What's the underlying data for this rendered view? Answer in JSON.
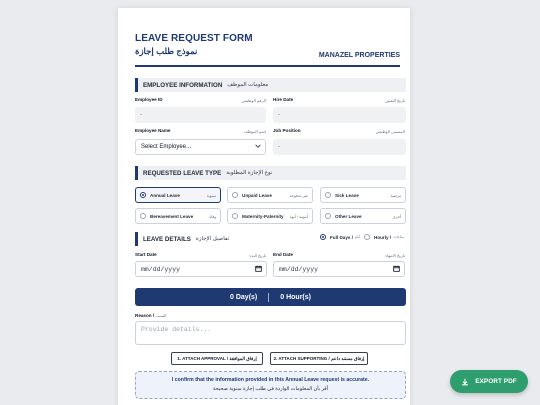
{
  "header": {
    "title": "LEAVE REQUEST FORM",
    "title_ar": "نموذج طلب إجازة",
    "company": "MANAZEL PROPERTIES"
  },
  "employee_info": {
    "heading": "EMPLOYEE INFORMATION",
    "heading_ar": "معلومات الموظف",
    "employee_id_label": "Employee ID",
    "employee_id_label_ar": "الرقم الوظيفي",
    "employee_id_value": "-",
    "hire_date_label": "Hire Date",
    "hire_date_label_ar": "تاريخ التعيين",
    "hire_date_value": "-",
    "employee_name_label": "Employee Name",
    "employee_name_label_ar": "اسم الموظف",
    "employee_name_selected": "Select Employee...",
    "job_position_label": "Job Position",
    "job_position_label_ar": "المسمى الوظيفي",
    "job_position_value": "-"
  },
  "leave_type": {
    "heading": "REQUESTED LEAVE TYPE",
    "heading_ar": "نوع الإجازة المطلوبة",
    "options": [
      {
        "label": "Annual Leave",
        "label_ar": "سنوية",
        "selected": true
      },
      {
        "label": "Unpaid Leave",
        "label_ar": "غير مدفوعة",
        "selected": false
      },
      {
        "label": "Sick Leave",
        "label_ar": "مرضية",
        "selected": false
      },
      {
        "label": "Bereavement Leave",
        "label_ar": "وفاة",
        "selected": false
      },
      {
        "label": "Maternity-Paternity",
        "label_ar": "أمومة / أبوة",
        "selected": false
      },
      {
        "label": "Other Leave",
        "label_ar": "أخرى",
        "selected": false
      }
    ]
  },
  "leave_details": {
    "heading": "LEAVE DETAILS",
    "heading_ar": "تفاصيل الإجازة",
    "full_days_label": "Full Days /",
    "full_days_label_ar": "أيام",
    "hourly_label": "Hourly /",
    "hourly_label_ar": "ساعات",
    "start_date_label": "Start Date",
    "start_date_label_ar": "تاريخ البدء",
    "start_date_placeholder": "mm/dd/yyyy",
    "end_date_label": "End Date",
    "end_date_label_ar": "تاريخ الانتهاء",
    "end_date_placeholder": "mm/dd/yyyy"
  },
  "summary": {
    "days": "0 Day(s)",
    "hours": "0 Hour(s)"
  },
  "reason": {
    "label": "Reason /",
    "label_ar": "السبب",
    "placeholder": "Provide details..."
  },
  "attachments": {
    "approval": "1. ATTACH APPROVAL / إرفاق الموافقة",
    "supporting": "2. ATTACH SUPPORTING / إرفاق مستند داعم"
  },
  "confirmation": {
    "text": "I confirm that the information provided in this Annual Leave request is accurate.",
    "text_ar": "أقر بأن المعلومات الواردة في طلب إجازة سنوية صحيحة"
  },
  "export_button": "EXPORT PDF",
  "colors": {
    "primary": "#1f3a73",
    "export": "#2e9e6f",
    "background": "#e9ebee"
  }
}
